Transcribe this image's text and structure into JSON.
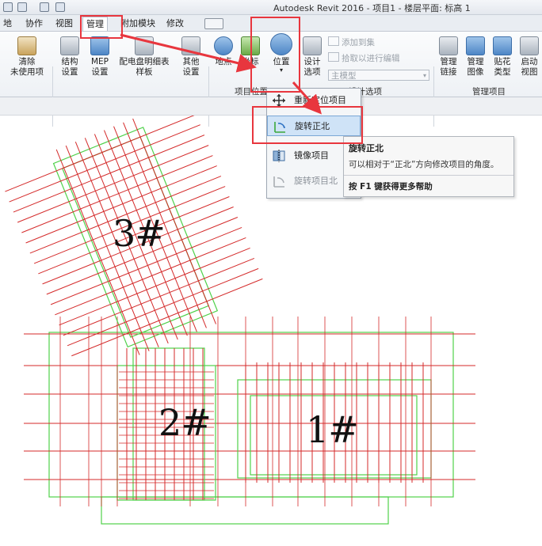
{
  "window": {
    "title": "Autodesk Revit 2016 -     项目1 - 楼层平面: 标高 1"
  },
  "tabs": [
    {
      "label": "地"
    },
    {
      "label": "协作"
    },
    {
      "label": "视图"
    },
    {
      "label": "管理"
    },
    {
      "label": "附加模块"
    },
    {
      "label": "修改"
    }
  ],
  "ribbon": {
    "purge": {
      "line1": "清除",
      "line2": "未使用项"
    },
    "structural": {
      "line1": "结构",
      "line2": "设置"
    },
    "mep": {
      "line1": "MEP",
      "line2": "设置"
    },
    "panel_schedule": {
      "line1": "配电盘明细表",
      "line2": "样板"
    },
    "other": {
      "line1": "其他",
      "line2": "设置"
    },
    "location": {
      "line1": "地点"
    },
    "coordinates": {
      "line1": "坐标"
    },
    "position": {
      "line1": "位置"
    },
    "design_options": {
      "line1": "设计",
      "line2": "选项"
    },
    "add_to_set": "添加到集",
    "pick_to_edit": "拾取以进行编辑",
    "main_model": "主模型",
    "manage_links": {
      "line1": "管理",
      "line2": "链接"
    },
    "manage_images": {
      "line1": "管理",
      "line2": "图像"
    },
    "decal_types": {
      "line1": "贴花",
      "line2": "类型"
    },
    "starting_view": {
      "line1": "启动",
      "line2": "视图"
    },
    "panel_project_location": "项目位置",
    "panel_design_options": "设计选项",
    "panel_manage_project": "管理项目"
  },
  "menu": {
    "items": [
      {
        "label": "重新定位项目",
        "icon": "relocate-icon"
      },
      {
        "label": "旋转正北",
        "icon": "rotate-true-north-icon"
      },
      {
        "label": "镜像项目",
        "icon": "mirror-project-icon"
      },
      {
        "label": "旋转项目北",
        "icon": "rotate-project-north-icon"
      }
    ]
  },
  "tooltip": {
    "title": "旋转正北",
    "description": "可以相对于“正北”方向修改项目的角度。",
    "help": "按 F1 键获得更多帮助"
  },
  "buildings": {
    "b1": "1#",
    "b2": "2#",
    "b3": "3#"
  },
  "colors": {
    "highlight_red": "#e8363e",
    "grid_red": "#d42a2a",
    "wall_green": "#4fd14a"
  }
}
